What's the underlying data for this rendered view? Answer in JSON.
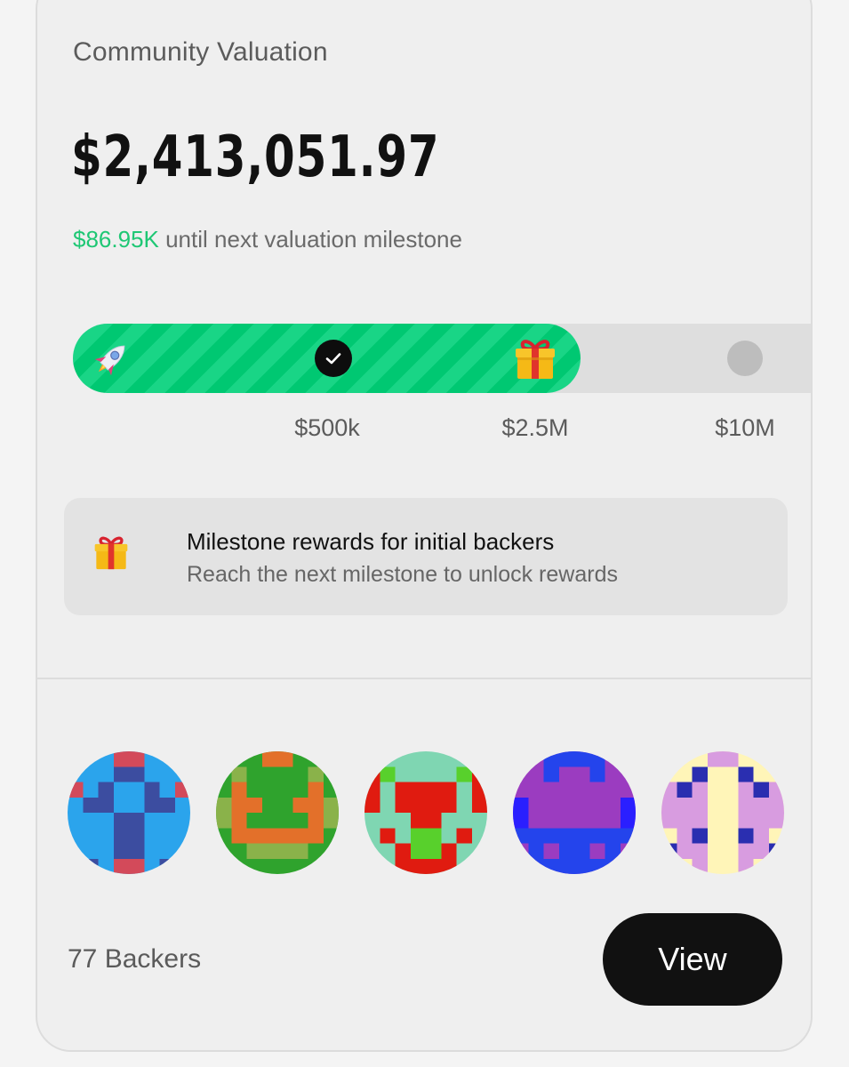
{
  "header": {
    "title": "Community Valuation"
  },
  "valuation": {
    "amount": "$2,413,051.97",
    "remaining": "$86.95K",
    "remaining_suffix": " until next valuation milestone"
  },
  "progress": {
    "fill_fraction": 0.68,
    "milestones": [
      {
        "label": "$500k",
        "status": "reached",
        "icon": "check-icon"
      },
      {
        "label": "$2.5M",
        "status": "next",
        "icon": "gift-icon"
      },
      {
        "label": "$10M",
        "status": "locked",
        "icon": "grey-dot-icon"
      }
    ],
    "start_icon": "rocket-icon",
    "colors": {
      "fill": "#00c872",
      "stripe": "#19d586",
      "track": "#dedede"
    }
  },
  "reward": {
    "icon": "gift-icon",
    "title": "Milestone rewards for initial backers",
    "subtitle": "Reach the next milestone to unlock rewards"
  },
  "backers": {
    "count_label": "77 Backers",
    "view_label": "View",
    "avatars": [
      {
        "name": "avatar-1",
        "palette": [
          "#2ba4ec",
          "#3c4da0",
          "#d34a5a"
        ]
      },
      {
        "name": "avatar-2",
        "palette": [
          "#2fa32d",
          "#e3702a",
          "#8ab24a"
        ]
      },
      {
        "name": "avatar-3",
        "palette": [
          "#7fd6b2",
          "#e01b10",
          "#58d02c"
        ]
      },
      {
        "name": "avatar-4",
        "palette": [
          "#9b3cc0",
          "#2444ec",
          "#2a1fff"
        ]
      },
      {
        "name": "avatar-5",
        "palette": [
          "#fff5b8",
          "#d89ce0",
          "#2a2eb0"
        ]
      }
    ]
  }
}
